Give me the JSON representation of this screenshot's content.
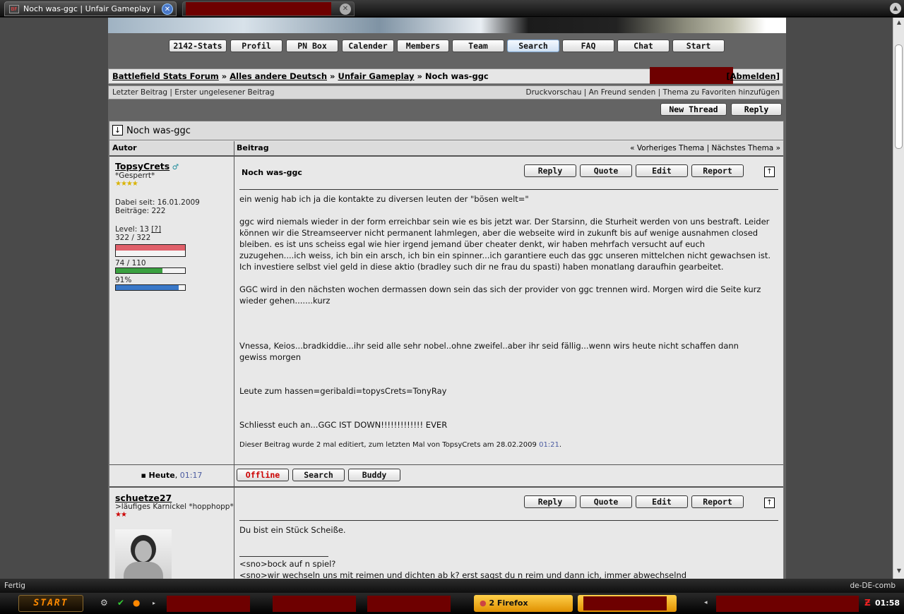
{
  "browser": {
    "tab_title": "Noch was-ggc | Unfair Gameplay | Bat...",
    "status_left": "Fertig",
    "status_right": "de-DE-comb"
  },
  "nav": {
    "items": [
      "2142-Stats",
      "Profil",
      "PN Box",
      "Calender",
      "Members",
      "Team",
      "Search",
      "FAQ",
      "Chat",
      "Start"
    ],
    "active": "Search"
  },
  "breadcrumb": {
    "items": [
      "Battlefield Stats Forum",
      "Alles andere Deutsch",
      "Unfair Gameplay"
    ],
    "current": "Noch was-ggc",
    "separator": "»",
    "logout": "[Abmelden]"
  },
  "subbar": {
    "left": "Letzter Beitrag | Erster ungelesener Beitrag",
    "right": "Druckvorschau | An Freund senden | Thema zu Favoriten hinzufügen"
  },
  "thread_buttons": {
    "new_thread": "New Thread",
    "reply": "Reply"
  },
  "thread": {
    "title": "Noch was-ggc",
    "col_author": "Autor",
    "col_post": "Beitrag",
    "prev": "« Vorheriges Thema",
    "sep": "|",
    "next": "Nächstes Thema »"
  },
  "post_buttons": {
    "reply": "Reply",
    "quote": "Quote",
    "edit": "Edit",
    "report": "Report"
  },
  "post1": {
    "author": "TopsyCrets",
    "gender_icon": "male-icon",
    "rank": "*Gesperrt*",
    "star_count": 4,
    "stars": "★★★★",
    "joined": "Dabei seit: 16.01.2009",
    "posts": "Beiträge: 222",
    "level": "Level: 13",
    "level_help": "[?]",
    "hp": "322 / 322",
    "hp_fraction": 1.0,
    "mp": "74 / 110",
    "mp_fraction": 0.6727,
    "exp": "91%",
    "exp_fraction": 0.91,
    "subject": "Noch was-ggc",
    "paragraphs": [
      "ein wenig hab ich ja die kontakte zu diversen leuten der \"bösen welt=\"",
      "ggc wird niemals wieder in der form erreichbar sein wie es bis jetzt war. Der Starsinn, die Sturheit werden von uns bestraft. Leider können wir die Streamseerver nicht permanent lahmlegen, aber die webseite wird in zukunft bis auf wenige ausnahmen closed bleiben. es ist uns scheiss egal wie hier irgend jemand über cheater denkt, wir haben mehrfach versucht auf euch zuzugehen....ich weiss, ich bin ein arsch, ich bin ein spinner...ich garantiere euch das ggc unseren mittelchen nicht gewachsen ist. Ich investiere selbst viel geld in diese aktio (bradley such dir ne frau du spasti) haben monatlang daraufhin gearbeitet.",
      "GGC wird in den nächsten wochen dermassen down sein das sich der provider von ggc trennen wird. Morgen wird die Seite kurz wieder gehen.......kurz",
      "Vnessa, Keios...bradkiddie...ihr seid alle sehr nobel..ohne zweifel..aber ihr seid fällig...wenn wirs heute nicht schaffen dann gewiss morgen",
      "Leute zum hassen=geribaldi=topysCrets=TonyRay",
      "Schliesst euch an...GGC IST DOWN!!!!!!!!!!!!! EVER"
    ],
    "edit_note": "Dieser Beitrag wurde 2 mal editiert, zum letzten Mal von TopsyCrets am 28.02.2009",
    "edit_time": "01:21",
    "edit_end": ".",
    "date_label": "Heute",
    "date_sep": ",",
    "time": "01:17",
    "footer_buttons": {
      "offline": "Offline",
      "search": "Search",
      "buddy": "Buddy"
    }
  },
  "post2": {
    "author": "schuetze27",
    "rank": ">läufiges Karnickel *hopphopp*",
    "star_count": 2,
    "stars": "★★",
    "body": "Du bist ein Stück Scheiße.",
    "quote1": "<sno>bock auf n spiel?",
    "quote2": "<sno>wir wechseln uns mit reimen und dichten ab k? erst sagst du n reim und dann ich, immer abwechselnd"
  },
  "taskbar": {
    "start": "START",
    "firefox": "2 Firefox",
    "clock": "01:58"
  },
  "colors": {
    "offline": "#cc0000",
    "hp": "#e0606a",
    "mp": "#3aa040",
    "exp": "#3a78c8",
    "time": "#4a5aa0"
  }
}
